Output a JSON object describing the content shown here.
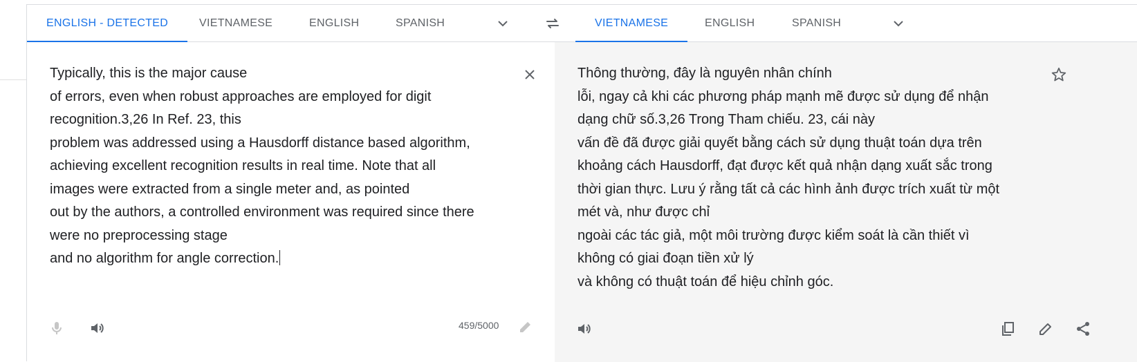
{
  "source_languages": [
    "ENGLISH - DETECTED",
    "VIETNAMESE",
    "ENGLISH",
    "SPANISH"
  ],
  "target_languages": [
    "VIETNAMESE",
    "ENGLISH",
    "SPANISH"
  ],
  "source": {
    "lines": [
      "Typically, this is the major cause",
      "of errors, even when robust approaches are employed for digit",
      "recognition.3,26 In Ref. 23, this",
      "problem was addressed using a Hausdorff distance based algorithm,",
      "achieving excellent recognition results in real time. Note that all",
      "images were extracted from a single meter and, as pointed",
      "out by the authors, a controlled environment was required since there",
      "were no preprocessing stage",
      "and no algorithm for angle correction."
    ],
    "char_count": "459/5000"
  },
  "target": {
    "lines": [
      "Thông thường, đây là nguyên nhân chính",
      "lỗi, ngay cả khi các phương pháp mạnh mẽ được sử dụng để nhận",
      "dạng chữ số.3,26 Trong Tham chiếu. 23, cái này",
      "vấn đề đã được giải quyết bằng cách sử dụng thuật toán dựa trên",
      "khoảng cách Hausdorff, đạt được kết quả nhận dạng xuất sắc trong",
      "thời gian thực. Lưu ý rằng tất cả các hình ảnh được trích xuất từ một",
      "mét và, như được chỉ",
      "ngoài các tác giả, một môi trường được kiểm soát là cần thiết vì",
      "không có giai đoạn tiền xử lý",
      "và không có thuật toán để hiệu chỉnh góc."
    ]
  },
  "icons": {
    "source_more": "chevron-down-icon",
    "swap": "swap-languages-icon",
    "target_more": "chevron-down-icon",
    "clear": "close-icon",
    "mic": "microphone-icon",
    "source_listen": "speaker-icon",
    "handwrite": "pencil-icon",
    "star": "star-icon",
    "target_listen": "speaker-icon",
    "copy": "copy-icon",
    "edit": "pencil-icon",
    "share": "share-icon"
  },
  "colors": {
    "accent": "#1a73e8",
    "text": "#202124",
    "muted": "#5f6368",
    "target_bg": "#f5f5f5"
  }
}
